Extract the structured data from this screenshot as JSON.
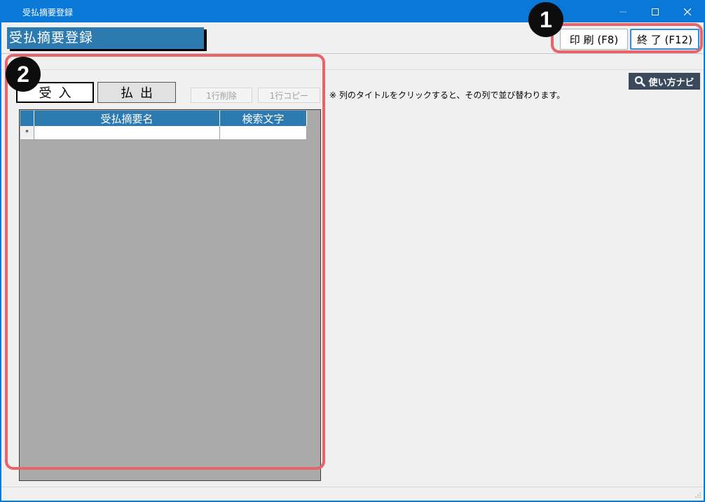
{
  "window": {
    "title": "受払摘要登録"
  },
  "header": {
    "screen_title": "受払摘要登録",
    "print_button": "印 刷 (F8)",
    "exit_button": "終 了 (F12)"
  },
  "navi": {
    "label": "使い方ナビ",
    "icon": "magnifier-icon"
  },
  "tabs": {
    "in_label": "受入",
    "out_label": "払出"
  },
  "toolbar": {
    "delete_row": "1行削除",
    "copy_row": "1行コピー"
  },
  "note": "※ 列のタイトルをクリックすると、その列で並び替わります。",
  "grid": {
    "columns": [
      "受払摘要名",
      "検索文字"
    ],
    "new_row_marker": "*",
    "rows": []
  },
  "callouts": {
    "one": "1",
    "two": "2"
  },
  "colors": {
    "title_bar": "#0a78d7",
    "header_blue": "#2d7ab0",
    "callout_red": "#e8646a",
    "navi_bg": "#3a4a5c"
  }
}
